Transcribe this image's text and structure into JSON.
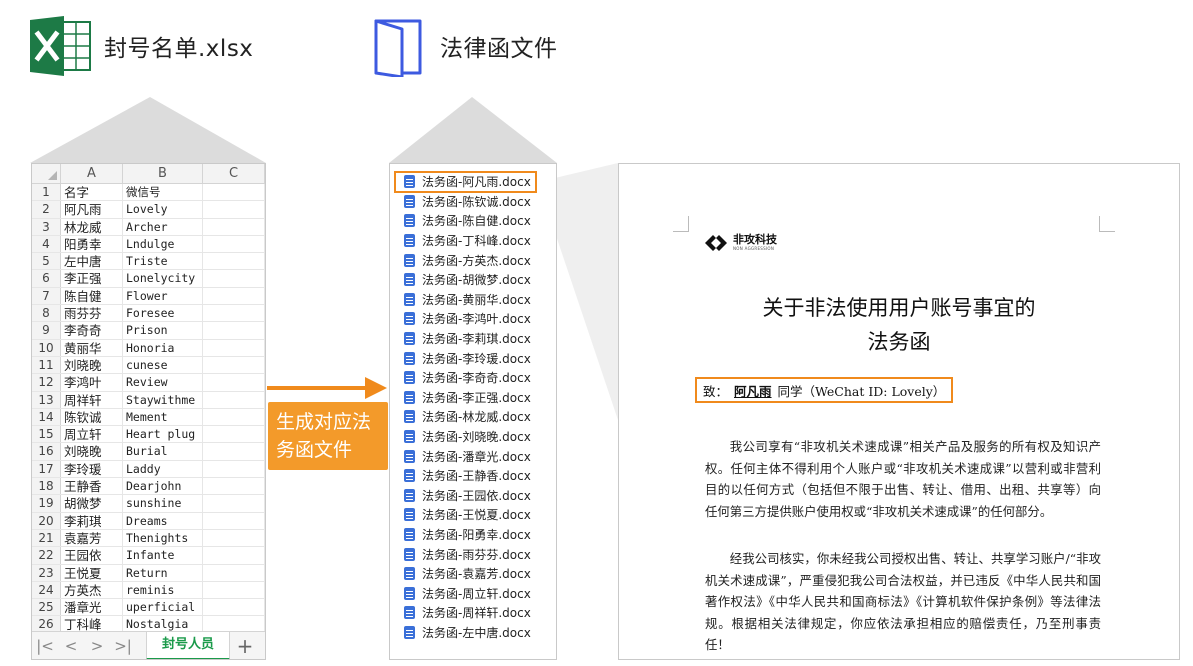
{
  "header": {
    "excel_label": "封号名单.xlsx",
    "folder_label": "法律函文件"
  },
  "colors": {
    "accent": "#f08a1c",
    "excel_green": "#1d7a46",
    "folder_blue": "#3d5ae0",
    "file_icon_blue": "#3a6fd8",
    "connector_gray": "#dcdcdc"
  },
  "spreadsheet": {
    "columns": [
      "A",
      "B",
      "C"
    ],
    "rows": [
      {
        "n": "1",
        "a": "名字",
        "b": "微信号"
      },
      {
        "n": "2",
        "a": "阿凡雨",
        "b": "Lovely"
      },
      {
        "n": "3",
        "a": "林龙威",
        "b": "Archer"
      },
      {
        "n": "4",
        "a": "阳勇幸",
        "b": "Lndulge"
      },
      {
        "n": "5",
        "a": "左中唐",
        "b": "Triste"
      },
      {
        "n": "6",
        "a": "李正强",
        "b": "Lonelycity"
      },
      {
        "n": "7",
        "a": "陈自健",
        "b": "Flower"
      },
      {
        "n": "8",
        "a": "雨芬芬",
        "b": "Foresee"
      },
      {
        "n": "9",
        "a": "李奇奇",
        "b": "Prison"
      },
      {
        "n": "10",
        "a": "黄丽华",
        "b": "Honoria"
      },
      {
        "n": "11",
        "a": "刘晓晚",
        "b": "cunese"
      },
      {
        "n": "12",
        "a": "李鸿叶",
        "b": "Review"
      },
      {
        "n": "13",
        "a": "周祥轩",
        "b": "Staywithme"
      },
      {
        "n": "14",
        "a": "陈钦诚",
        "b": "Mement"
      },
      {
        "n": "15",
        "a": "周立轩",
        "b": "Heart plug"
      },
      {
        "n": "16",
        "a": "刘晓晚",
        "b": "Burial"
      },
      {
        "n": "17",
        "a": "李玲瑗",
        "b": "Laddy"
      },
      {
        "n": "18",
        "a": "王静香",
        "b": "Dearjohn"
      },
      {
        "n": "19",
        "a": "胡微梦",
        "b": "sunshine"
      },
      {
        "n": "20",
        "a": "李莉琪",
        "b": "Dreams"
      },
      {
        "n": "21",
        "a": "袁嘉芳",
        "b": "Thenights"
      },
      {
        "n": "22",
        "a": "王园依",
        "b": "Infante"
      },
      {
        "n": "23",
        "a": "王悦夏",
        "b": "Return"
      },
      {
        "n": "24",
        "a": "方英杰",
        "b": "reminis"
      },
      {
        "n": "25",
        "a": "潘章光",
        "b": "uperficial"
      },
      {
        "n": "26",
        "a": "丁科峰",
        "b": "Nostalgia"
      }
    ],
    "sheet_tab": "封号人员",
    "add_tab": "+",
    "nav": [
      "|<",
      "<",
      ">",
      ">|"
    ]
  },
  "arrow_label": "生成对应法务函文件",
  "callout_lines": [
    "生成对应法",
    "务函文件"
  ],
  "files": [
    "法务函-阿凡雨.docx",
    "法务函-陈钦诚.docx",
    "法务函-陈自健.docx",
    "法务函-丁科峰.docx",
    "法务函-方英杰.docx",
    "法务函-胡微梦.docx",
    "法务函-黄丽华.docx",
    "法务函-李鸿叶.docx",
    "法务函-李莉琪.docx",
    "法务函-李玲瑗.docx",
    "法务函-李奇奇.docx",
    "法务函-李正强.docx",
    "法务函-林龙威.docx",
    "法务函-刘晓晚.docx",
    "法务函-潘章光.docx",
    "法务函-王静香.docx",
    "法务函-王园依.docx",
    "法务函-王悦夏.docx",
    "法务函-阳勇幸.docx",
    "法务函-雨芬芬.docx",
    "法务函-袁嘉芳.docx",
    "法务函-周立轩.docx",
    "法务函-周祥轩.docx",
    "法务函-左中唐.docx"
  ],
  "document": {
    "logo_name": "非攻科技",
    "logo_sub": "NON AGGRESSION",
    "title_line1": "关于非法使用用户账号事宜的",
    "title_line2": "法务函",
    "to_prefix": "致：",
    "to_name": "阿凡雨",
    "to_suffix": "同学（WeChat ID: Lovely）",
    "paragraph1": "我公司享有“非攻机关术速成课”相关产品及服务的所有权及知识产权。任何主体不得利用个人账户或“非攻机关术速成课”以营利或非营利目的以任何方式（包括但不限于出售、转让、借用、出租、共享等）向任何第三方提供账户使用权或“非攻机关术速成课”的任何部分。",
    "paragraph2": "经我公司核实，你未经我公司授权出售、转让、共享学习账户/“非攻机关术速成课”，严重侵犯我公司合法权益，并已违反《中华人民共和国著作权法》《中华人民共和国商标法》《计算机软件保护条例》等法律法规。根据相关法律规定，你应依法承担相应的赔偿责任，乃至刑事责任！"
  }
}
